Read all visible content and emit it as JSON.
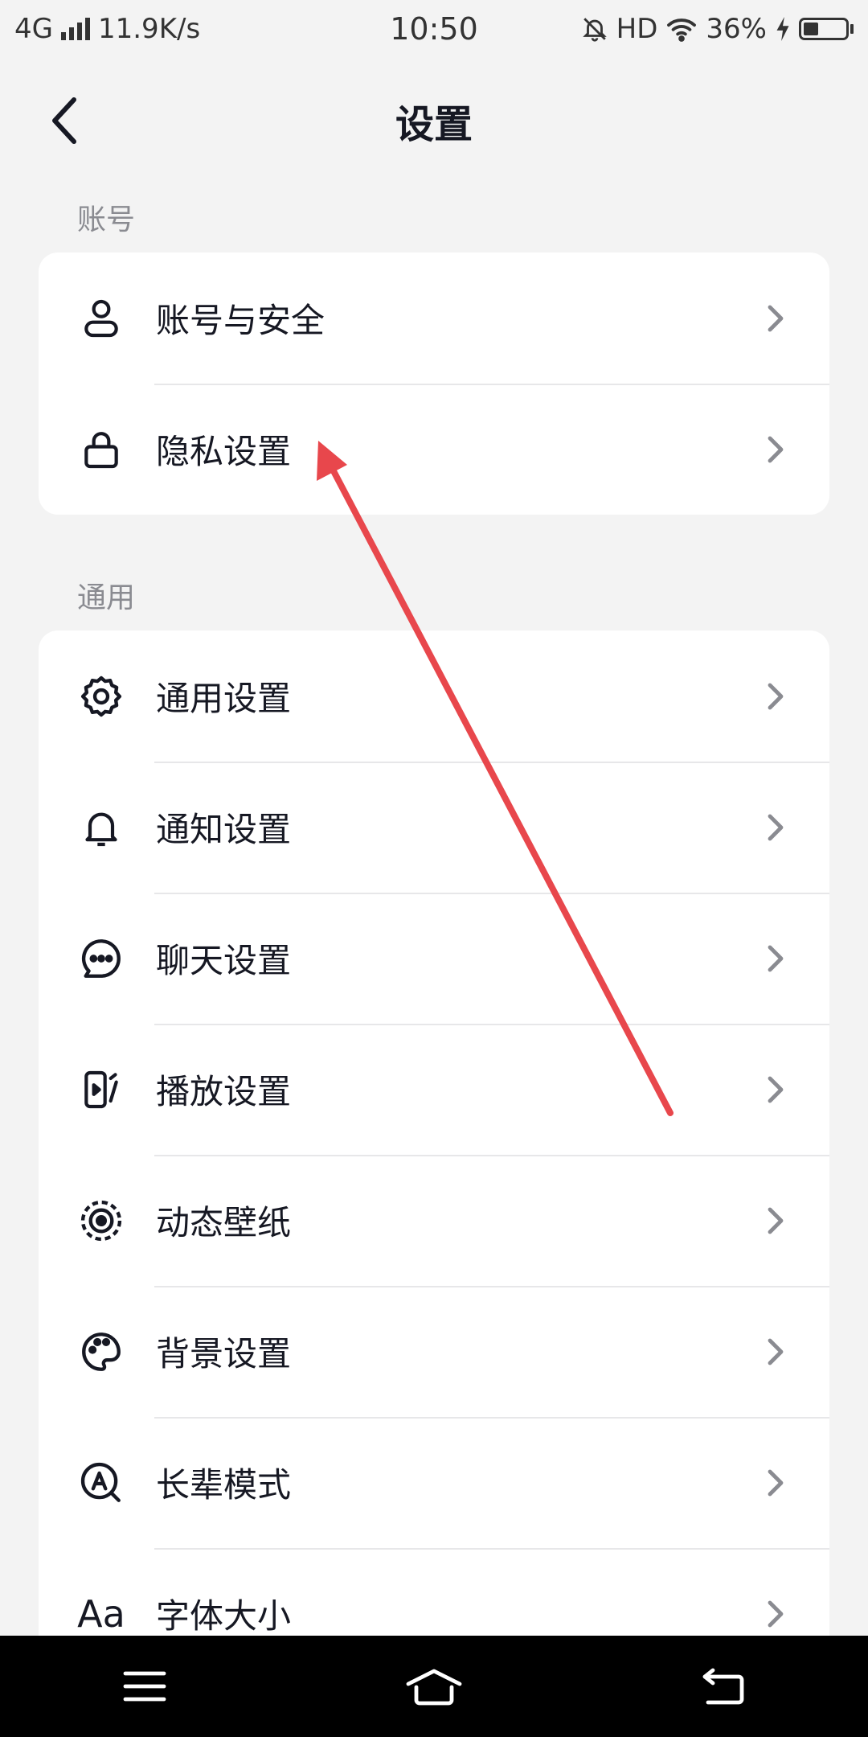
{
  "status_bar": {
    "network": "4G",
    "speed": "11.9K/s",
    "time": "10:50",
    "hd": "HD",
    "battery": "36%",
    "battery_level": 0.36
  },
  "header": {
    "title": "设置"
  },
  "sections": [
    {
      "label": "账号",
      "items": [
        {
          "label": "账号与安全",
          "icon": "user-icon"
        },
        {
          "label": "隐私设置",
          "icon": "lock-icon"
        }
      ]
    },
    {
      "label": "通用",
      "items": [
        {
          "label": "通用设置",
          "icon": "gear-icon"
        },
        {
          "label": "通知设置",
          "icon": "bell-icon"
        },
        {
          "label": "聊天设置",
          "icon": "chat-bubble-icon"
        },
        {
          "label": "播放设置",
          "icon": "play-device-icon"
        },
        {
          "label": "动态壁纸",
          "icon": "live-wallpaper-icon"
        },
        {
          "label": "背景设置",
          "icon": "palette-icon"
        },
        {
          "label": "长辈模式",
          "icon": "elder-mode-icon"
        },
        {
          "label": "字体大小",
          "icon": "font-size-icon",
          "icon_text": "Aa"
        }
      ]
    }
  ],
  "colors": {
    "background": "#f3f3f3",
    "card": "#ffffff",
    "text": "#161823",
    "muted": "#8a8b91",
    "annotation_arrow": "#e8474c"
  }
}
